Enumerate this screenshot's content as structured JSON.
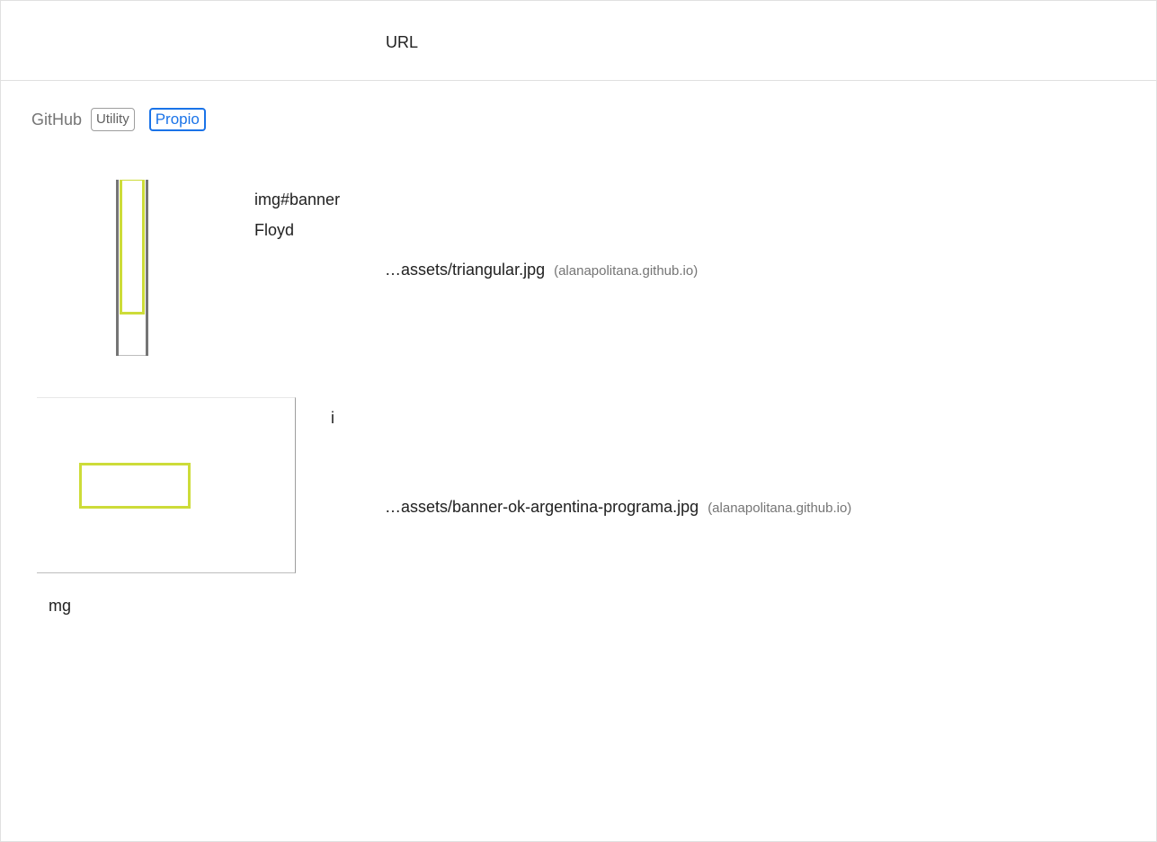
{
  "header": {
    "url_column_label": "URL"
  },
  "entity": {
    "name": "GitHub",
    "badges": [
      "Utility",
      "Propio"
    ]
  },
  "items": [
    {
      "node_label": "img#bannerFloyd",
      "url": "…assets/triangular.jpg",
      "host": "(alanapolitana.github.io)"
    },
    {
      "node_label_start": "i",
      "node_label_end": "mg",
      "url": "…assets/banner-ok-argentina-programa.jpg",
      "host": "(alanapolitana.github.io)"
    }
  ],
  "colors": {
    "highlight": "#cddc39",
    "badge_accent": "#1a73e8",
    "muted_text": "#757575"
  }
}
